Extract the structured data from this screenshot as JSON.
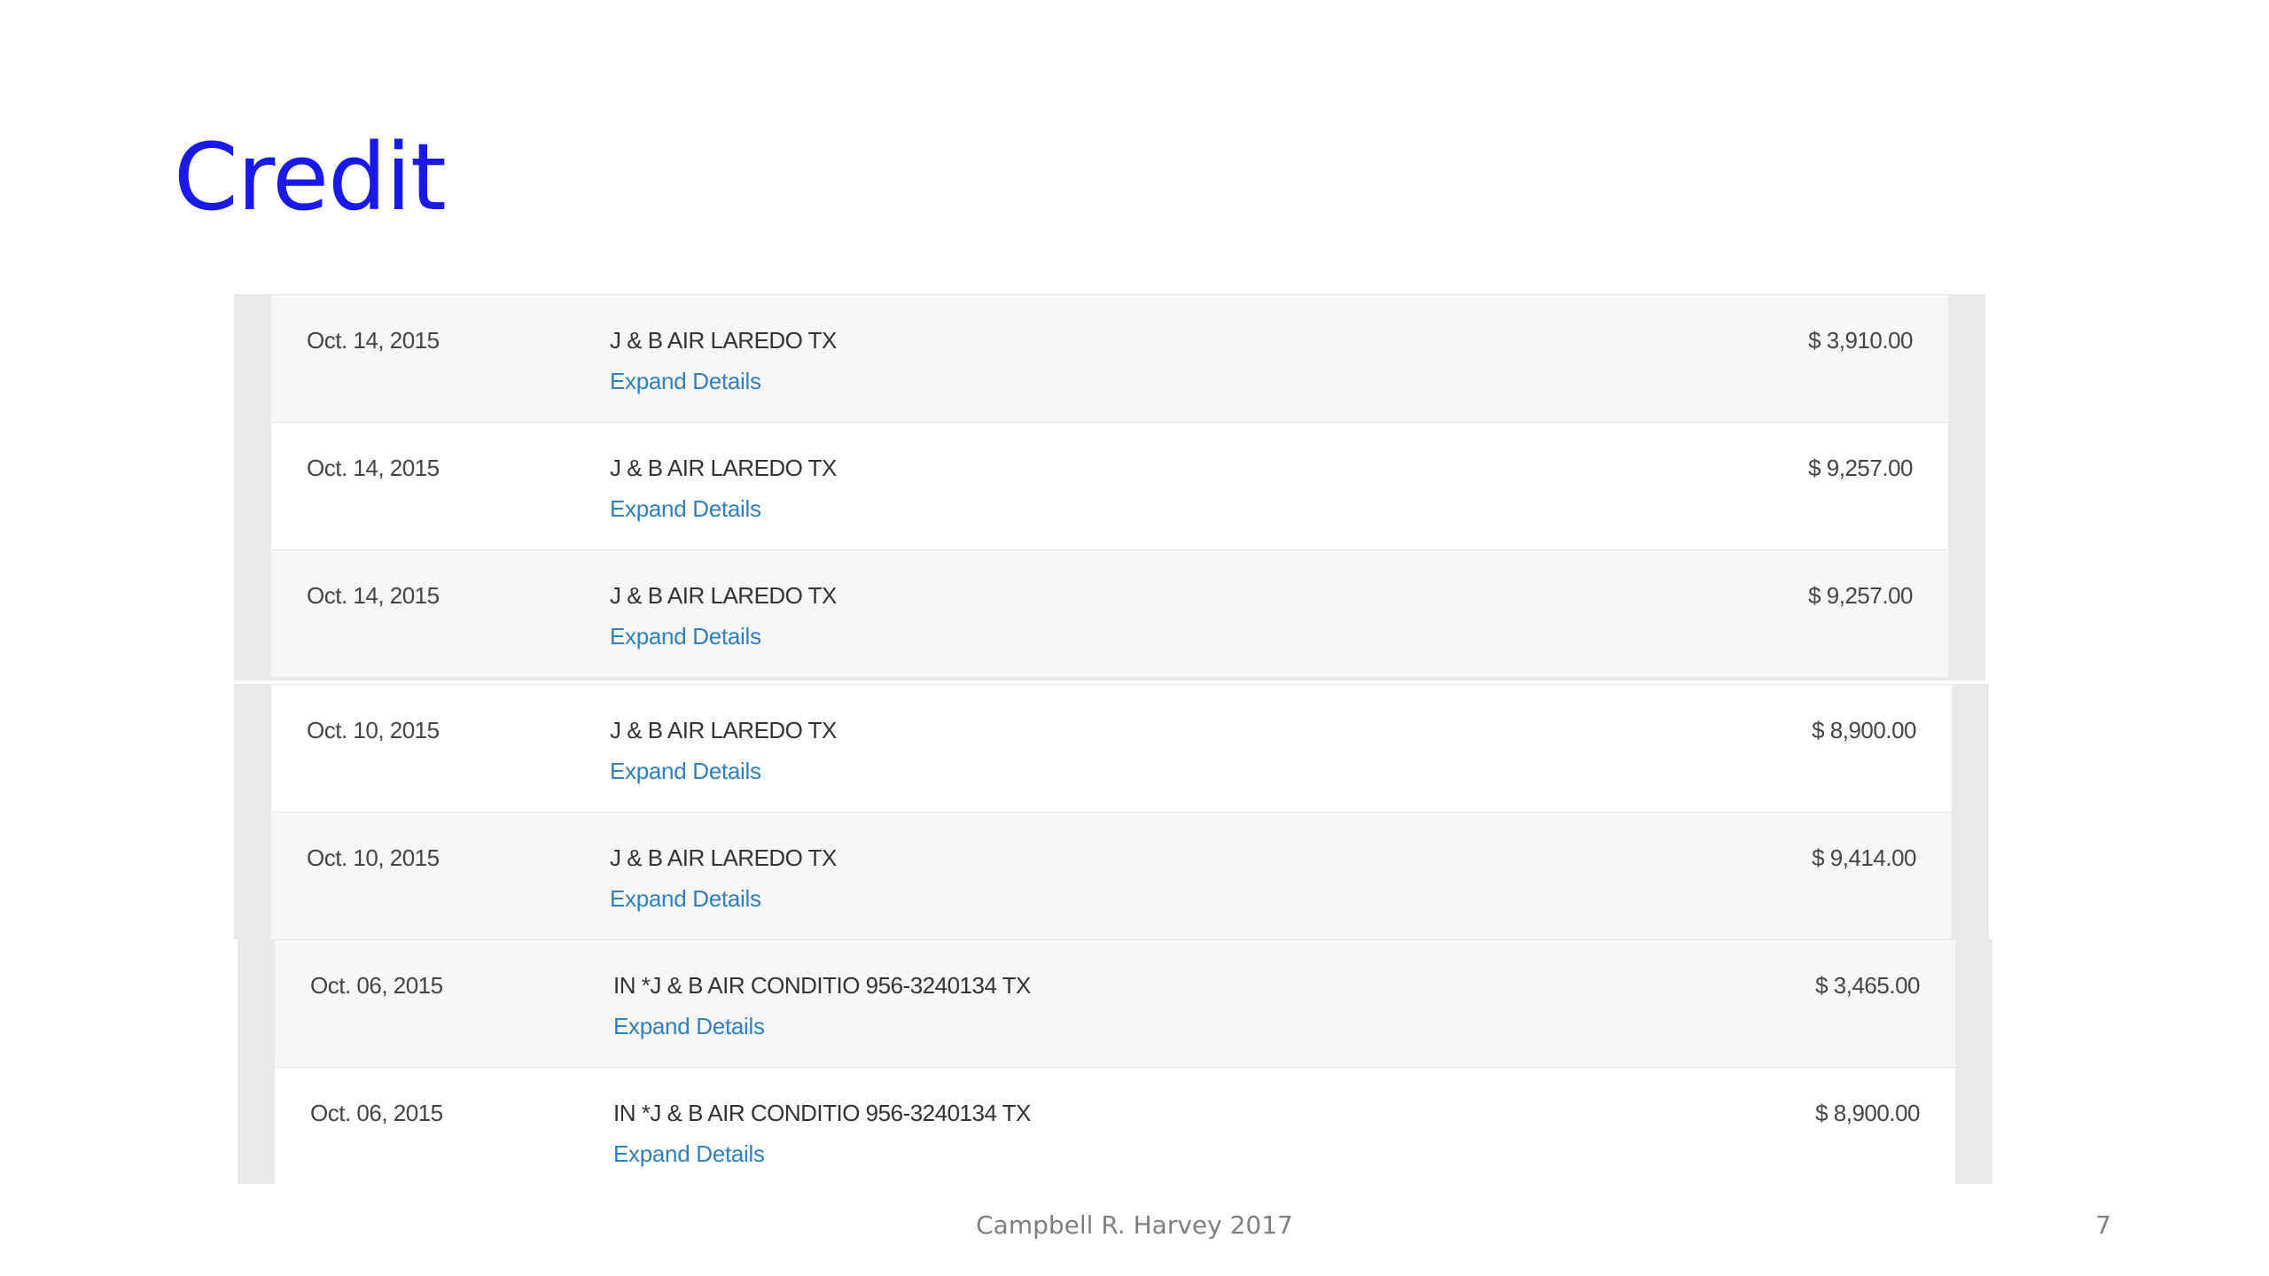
{
  "slide": {
    "title": "Credit",
    "footer": "Campbell R. Harvey 2017",
    "page_number": "7"
  },
  "transactions_a": [
    {
      "date": "Oct. 14, 2015",
      "description": "J & B AIR LAREDO TX",
      "link": "Expand Details",
      "amount": "$ 3,910.00"
    },
    {
      "date": "Oct. 14, 2015",
      "description": "J & B AIR LAREDO TX",
      "link": "Expand Details",
      "amount": "$ 9,257.00"
    },
    {
      "date": "Oct. 14, 2015",
      "description": "J & B AIR LAREDO TX",
      "link": "Expand Details",
      "amount": "$ 9,257.00"
    }
  ],
  "transactions_b": [
    {
      "date": "Oct. 10, 2015",
      "description": "J & B AIR LAREDO TX",
      "link": "Expand Details",
      "amount": "$ 8,900.00"
    },
    {
      "date": "Oct. 10, 2015",
      "description": "J & B AIR LAREDO TX",
      "link": "Expand Details",
      "amount": "$ 9,414.00"
    }
  ],
  "transactions_c": [
    {
      "date": "Oct. 06, 2015",
      "description": "IN *J & B AIR CONDITIO 956-3240134 TX",
      "link": "Expand Details",
      "amount": "$ 3,465.00"
    },
    {
      "date": "Oct. 06, 2015",
      "description": "IN *J & B AIR CONDITIO 956-3240134 TX",
      "link": "Expand Details",
      "amount": "$ 8,900.00"
    }
  ]
}
